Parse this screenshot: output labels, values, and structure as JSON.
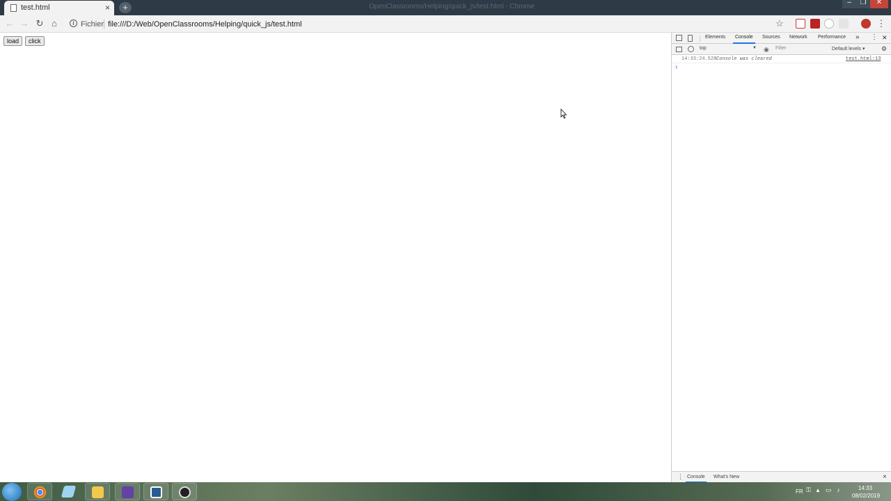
{
  "window": {
    "title": "OpenClassrooms/Helping/quick_js/test.html - Chrome",
    "min_glyph": "–",
    "max_glyph": "❐",
    "close_glyph": "✕"
  },
  "tabs": [
    {
      "title": "test.html",
      "close_glyph": "×"
    }
  ],
  "newtab_glyph": "+",
  "nav": {
    "back_glyph": "←",
    "forward_glyph": "→",
    "reload_glyph": "↻",
    "home_glyph": "⌂",
    "info_glyph": "i"
  },
  "omnibox": {
    "label": "Fichier",
    "url": "file:///D:/Web/OpenClassrooms/Helping/quick_js/test.html"
  },
  "toolbar_icons": {
    "star_glyph": "☆",
    "menu_glyph": "⋮"
  },
  "page": {
    "buttons": [
      {
        "label": "load"
      },
      {
        "label": "click"
      }
    ]
  },
  "devtools": {
    "tabs": [
      {
        "label": "Elements"
      },
      {
        "label": "Console",
        "active": true
      },
      {
        "label": "Sources"
      },
      {
        "label": "Network"
      },
      {
        "label": "Performance"
      }
    ],
    "more_glyph": "»",
    "kebab_glyph": "⋮",
    "close_glyph": "✕",
    "context": "top",
    "filter_placeholder": "Filter",
    "levels": "Default levels ▾",
    "log": [
      {
        "time": "14:33:24.528",
        "message": "Console was cleared",
        "source": "test.html:13"
      }
    ],
    "prompt_glyph": "›",
    "drawer_tabs": [
      {
        "label": "Console",
        "active": true
      },
      {
        "label": "What's New"
      }
    ],
    "drawer_close_glyph": "×",
    "accent_color": "#1a73e8"
  },
  "taskbar": {
    "lang": "FR",
    "time": "14:33",
    "date": "08/02/2019",
    "apps": [
      "chrome",
      "notepad",
      "file-explorer",
      "twitch",
      "brackets",
      "obs"
    ]
  }
}
